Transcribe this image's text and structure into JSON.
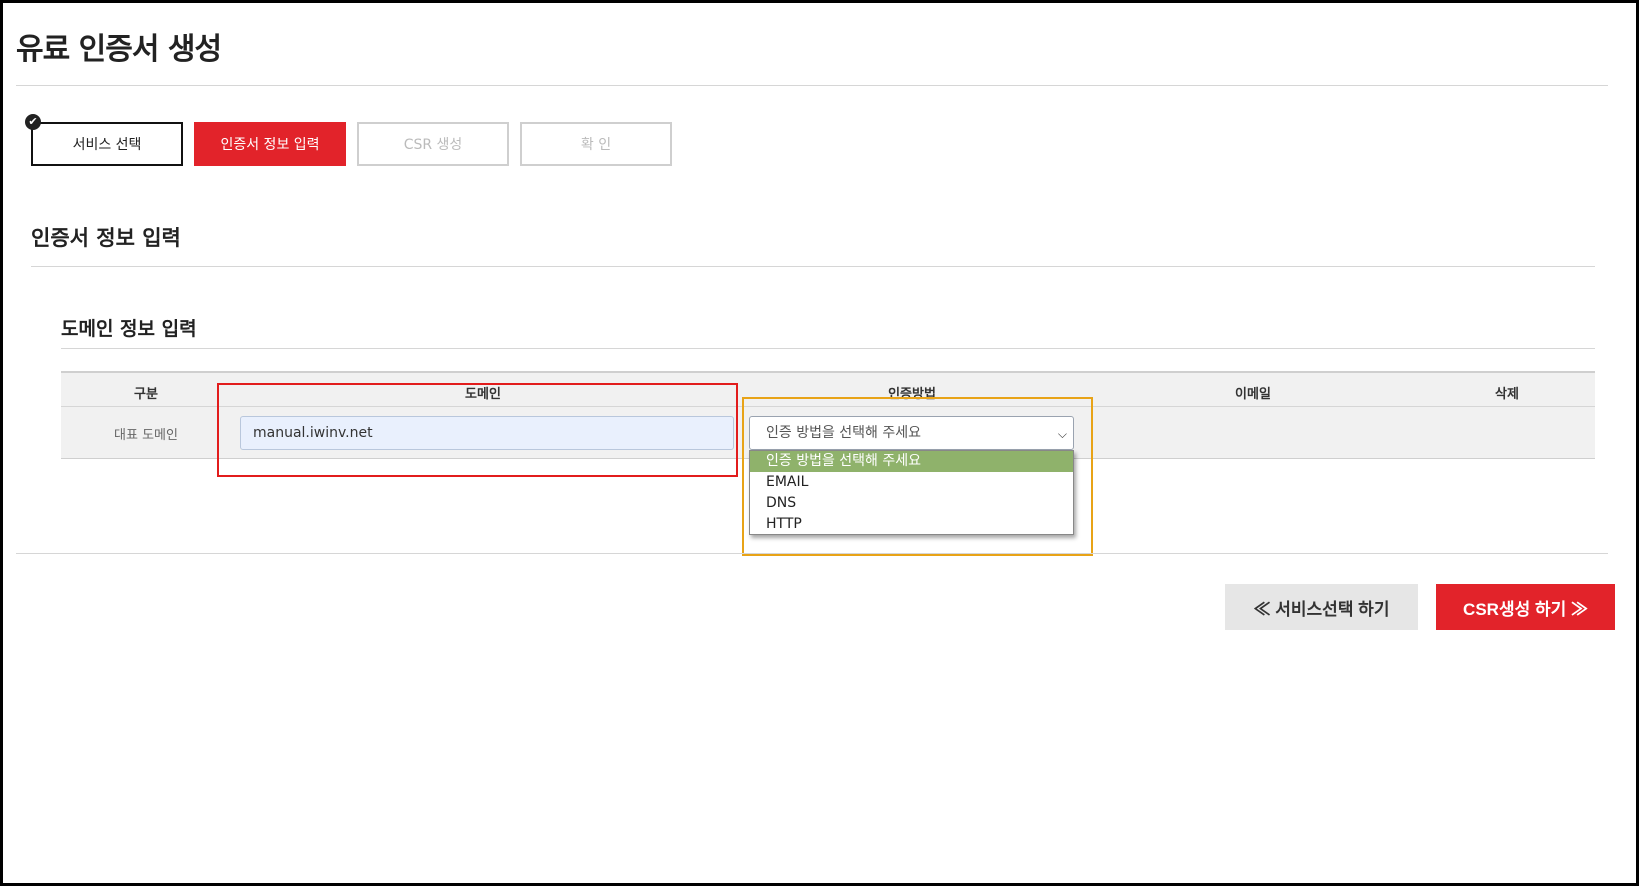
{
  "page": {
    "title": "유료 인증서 생성"
  },
  "steps": [
    {
      "label": "서비스 선택",
      "state": "done"
    },
    {
      "label": "인증서 정보 입력",
      "state": "active"
    },
    {
      "label": "CSR 생성",
      "state": "disabled"
    },
    {
      "label": "확 인",
      "state": "disabled"
    }
  ],
  "section": {
    "title": "인증서 정보 입력"
  },
  "domain_section": {
    "title": "도메인 정보 입력"
  },
  "table": {
    "headers": [
      "구분",
      "도메인",
      "인증방법",
      "이메일",
      "삭제"
    ],
    "row": {
      "label": "대표 도메인",
      "domain_value": "manual.iwinv.net",
      "method_selected": "인증 방법을 선택해 주세요"
    }
  },
  "dropdown": {
    "options": [
      "인증 방법을 선택해 주세요",
      "EMAIL",
      "DNS",
      "HTTP"
    ],
    "highlighted_index": 0
  },
  "buttons": {
    "prev": "≪ 서비스선택 하기",
    "next": "CSR생성 하기 ≫"
  },
  "icons": {
    "step_done": "check-circle-icon",
    "select": "chevron-down-icon"
  },
  "colors": {
    "accent": "#e2232a",
    "highlight_box": "#e21c1c",
    "dropdown_box": "#e8a317",
    "option_selected": "#8fb26b"
  }
}
